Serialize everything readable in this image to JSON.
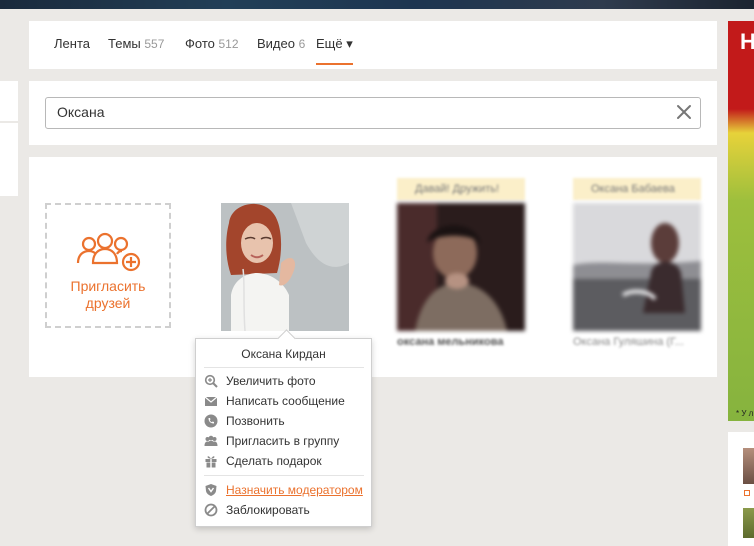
{
  "tabs": [
    {
      "label": "Лента",
      "count": ""
    },
    {
      "label": "Темы",
      "count": "557"
    },
    {
      "label": "Фото",
      "count": "512"
    },
    {
      "label": "Видео",
      "count": "6"
    },
    {
      "label": "Ещё ▾",
      "count": ""
    }
  ],
  "search": {
    "value": "Оксана"
  },
  "invite": {
    "label_line1": "Пригласить",
    "label_line2": "друзей"
  },
  "cards": [
    {
      "name": "Оксана Кирдан"
    },
    {
      "badge": "Давай! Дружить!",
      "name": "оксана мельникова"
    },
    {
      "badge": "Оксана Бабаева",
      "name": "Оксана Гуляшина (Г..."
    }
  ],
  "popup": {
    "title": "Оксана Кирдан",
    "items": [
      {
        "label": "Увеличить фото",
        "icon": "zoom-in-icon"
      },
      {
        "label": "Написать сообщение",
        "icon": "envelope-icon"
      },
      {
        "label": "Позвонить",
        "icon": "phone-icon"
      },
      {
        "label": "Пригласить в группу",
        "icon": "group-icon"
      },
      {
        "label": "Сделать подарок",
        "icon": "gift-icon"
      },
      {
        "label": "Назначить модератором",
        "icon": "shield-icon"
      },
      {
        "label": "Заблокировать",
        "icon": "block-icon"
      }
    ]
  },
  "ad": {
    "heading": "Н",
    "note": "* У л"
  },
  "colors": {
    "accent": "#eb722e",
    "background": "#ebe9e6",
    "ad_red": "#c21a1a"
  }
}
